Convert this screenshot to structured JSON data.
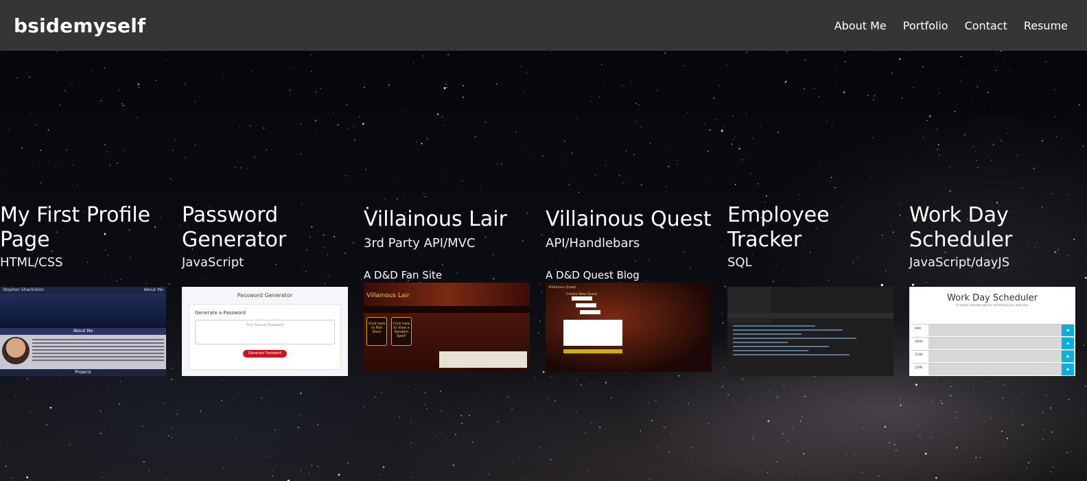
{
  "navbar": {
    "brand": "bsidemyself",
    "links": [
      "About Me",
      "Portfolio",
      "Contact",
      "Resume"
    ]
  },
  "projects": [
    {
      "title": "My First Profile Page",
      "tech": "HTML/CSS",
      "shot": {
        "name": "Stephen Shackleton",
        "nav": "About Me",
        "section": "About Me",
        "footer": "Projects"
      }
    },
    {
      "title": "Password Generator",
      "tech": "JavaScript",
      "shot": {
        "title": "Password Generator",
        "label": "Generate a Password",
        "placeholder": "Your Secure Password",
        "button": "Generate Password"
      }
    },
    {
      "title": "Villainous Lair",
      "tech": "3rd Party API/MVC",
      "description": "A D&D Fan Site",
      "shot": {
        "title": "Villainous Lair",
        "button_1": "Click here to Roll Dice!",
        "button_2": "Click here to View a Random Spell!"
      }
    },
    {
      "title": "Villainous Quest",
      "tech": "API/Handlebars",
      "description": "A D&D Quest Blog",
      "shot": {
        "title": "Villainous Quest",
        "label": "Create New Quest"
      }
    },
    {
      "title": "Employee Tracker",
      "tech": "SQL"
    },
    {
      "title": "Work Day Scheduler",
      "tech": "JavaScript/dayJS",
      "shot": {
        "title": "Work Day Scheduler",
        "subtitle": "A simple calendar app for scheduling your work day",
        "hours": [
          "9AM",
          "10AM",
          "11AM",
          "12PM"
        ]
      }
    }
  ]
}
